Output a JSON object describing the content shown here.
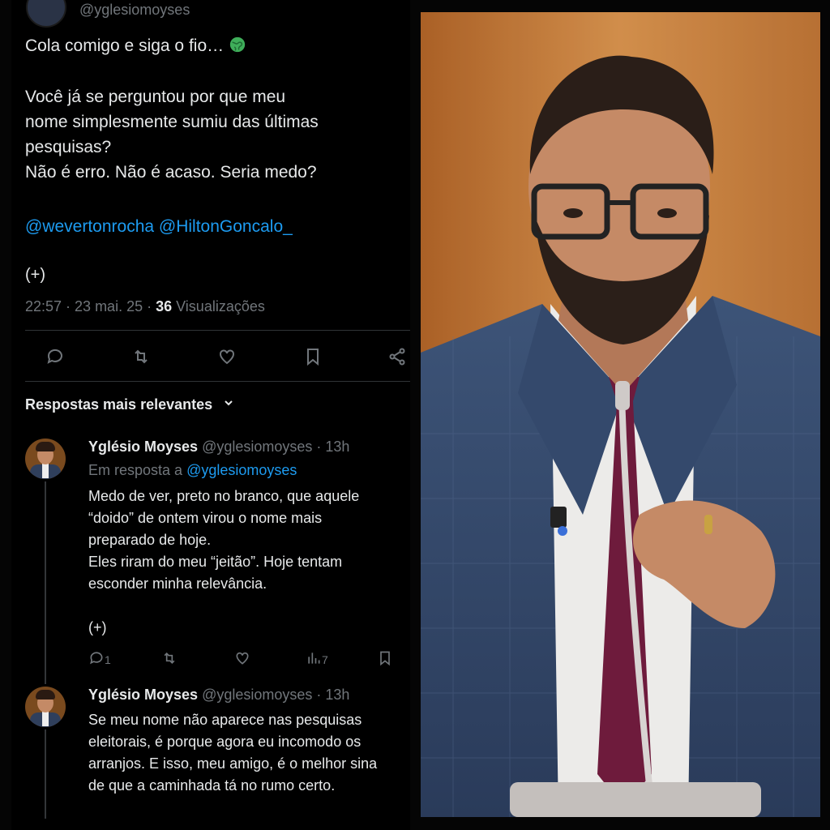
{
  "tweet": {
    "top_handle": "@yglesiomoyses",
    "line1": "Cola comigo e siga o fio…",
    "globe_icon": "globe-icon",
    "line2": "Você já se perguntou por que meu",
    "line3": "nome simplesmente sumiu das últimas",
    "line4": "pesquisas?",
    "line5": "Não é erro. Não é acaso. Seria medo?",
    "mention1": "@wevertonrocha",
    "mention2": "@HiltonGoncalo_",
    "more": "(+)",
    "time": "22:57 · 23 mai. 25 · ",
    "views_count": "36",
    "views_label": " Visualizações"
  },
  "actions": [
    "comment-icon",
    "retweet-icon",
    "like-icon",
    "bookmark-icon",
    "share-icon"
  ],
  "filter": {
    "label": "Respostas mais relevantes"
  },
  "replies": [
    {
      "name": "Yglésio Moyses",
      "handle": "@yglesiomoyses · 13h",
      "reply_to_prefix": "Em resposta a ",
      "reply_to_handle": "@yglesiomoyses",
      "lines": [
        "Medo de ver, preto no branco, que aquele",
        "“doido” de ontem virou o nome mais",
        "preparado de hoje.",
        "Eles riram do meu “jeitão”. Hoje tentam",
        "esconder minha relevância."
      ],
      "more": "(+)",
      "reply_count": "1",
      "views_count": "7"
    },
    {
      "name": "Yglésio Moyses",
      "handle": "@yglesiomoyses · 13h",
      "lines": [
        "Se meu nome não aparece nas pesquisas",
        "eleitorais, é porque agora eu incomodo os",
        "arranjos. E isso, meu amigo, é o melhor sina",
        "de que a caminhada tá no rumo certo."
      ]
    }
  ],
  "colors": {
    "accent": "#1d9bf0",
    "muted": "#71767b",
    "text": "#e7e9ea"
  }
}
